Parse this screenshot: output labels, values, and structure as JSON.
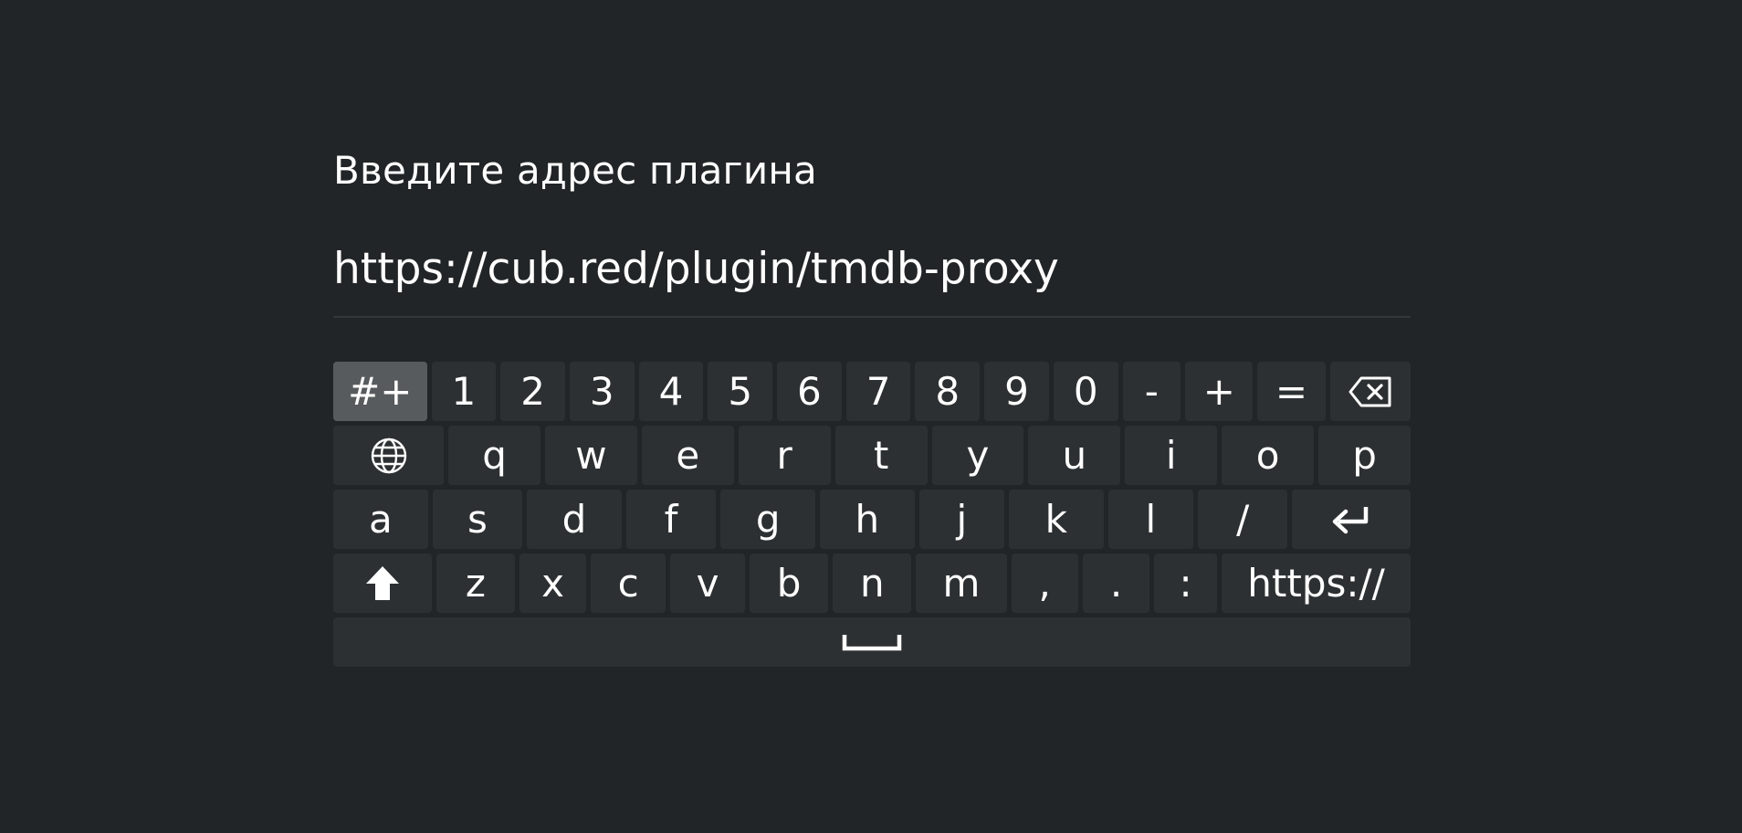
{
  "dialog": {
    "title": "Введите адрес плагина",
    "input_value": "https://cub.red/plugin/tmdb-proxy"
  },
  "keyboard": {
    "row1": [
      {
        "label": "#+",
        "name": "symbols-toggle-key",
        "grow": 1.45,
        "selected": true
      },
      {
        "label": "1",
        "name": "key-1"
      },
      {
        "label": "2",
        "name": "key-2"
      },
      {
        "label": "3",
        "name": "key-3"
      },
      {
        "label": "4",
        "name": "key-4"
      },
      {
        "label": "5",
        "name": "key-5"
      },
      {
        "label": "6",
        "name": "key-6"
      },
      {
        "label": "7",
        "name": "key-7"
      },
      {
        "label": "8",
        "name": "key-8"
      },
      {
        "label": "9",
        "name": "key-9"
      },
      {
        "label": "0",
        "name": "key-0"
      },
      {
        "label": "-",
        "name": "key-minus",
        "grow": 0.9
      },
      {
        "label": "+",
        "name": "key-plus",
        "grow": 1.05
      },
      {
        "label": "=",
        "name": "key-equals",
        "grow": 1.05
      },
      {
        "icon": "backspace-icon",
        "name": "backspace-key",
        "grow": 1.25
      }
    ],
    "row2": [
      {
        "icon": "globe-icon",
        "name": "language-key",
        "grow": 1.2
      },
      {
        "label": "q",
        "name": "key-q"
      },
      {
        "label": "w",
        "name": "key-w"
      },
      {
        "label": "e",
        "name": "key-e"
      },
      {
        "label": "r",
        "name": "key-r"
      },
      {
        "label": "t",
        "name": "key-t"
      },
      {
        "label": "y",
        "name": "key-y"
      },
      {
        "label": "u",
        "name": "key-u"
      },
      {
        "label": "i",
        "name": "key-i"
      },
      {
        "label": "o",
        "name": "key-o"
      },
      {
        "label": "p",
        "name": "key-p"
      }
    ],
    "row3": [
      {
        "label": "a",
        "name": "key-a"
      },
      {
        "label": "s",
        "name": "key-s",
        "grow": 0.95
      },
      {
        "label": "d",
        "name": "key-d"
      },
      {
        "label": "f",
        "name": "key-f",
        "grow": 0.95
      },
      {
        "label": "g",
        "name": "key-g"
      },
      {
        "label": "h",
        "name": "key-h"
      },
      {
        "label": "j",
        "name": "key-j",
        "grow": 0.9
      },
      {
        "label": "k",
        "name": "key-k"
      },
      {
        "label": "l",
        "name": "key-l",
        "grow": 0.9
      },
      {
        "label": "/",
        "name": "key-slash",
        "grow": 0.95
      },
      {
        "icon": "enter-icon",
        "name": "enter-key",
        "grow": 1.25
      }
    ],
    "row4": [
      {
        "icon": "shift-arrow-icon",
        "name": "shift-key",
        "grow": 1.25
      },
      {
        "label": "z",
        "name": "key-z"
      },
      {
        "label": "x",
        "name": "key-x",
        "grow": 0.85
      },
      {
        "label": "c",
        "name": "key-c",
        "grow": 0.95
      },
      {
        "label": "v",
        "name": "key-v",
        "grow": 0.95
      },
      {
        "label": "b",
        "name": "key-b",
        "grow": 1.0
      },
      {
        "label": "n",
        "name": "key-n",
        "grow": 1.0
      },
      {
        "label": "m",
        "name": "key-m",
        "grow": 1.15
      },
      {
        "label": ",",
        "name": "key-comma",
        "grow": 0.85
      },
      {
        "label": ".",
        "name": "key-period",
        "grow": 0.85
      },
      {
        "label": ":",
        "name": "key-colon",
        "grow": 0.8
      },
      {
        "label": "https://",
        "name": "https-prefix-key",
        "grow": 2.4
      }
    ],
    "row5": [
      {
        "icon": "space-bar-icon",
        "name": "space-key",
        "grow": 1
      }
    ]
  }
}
